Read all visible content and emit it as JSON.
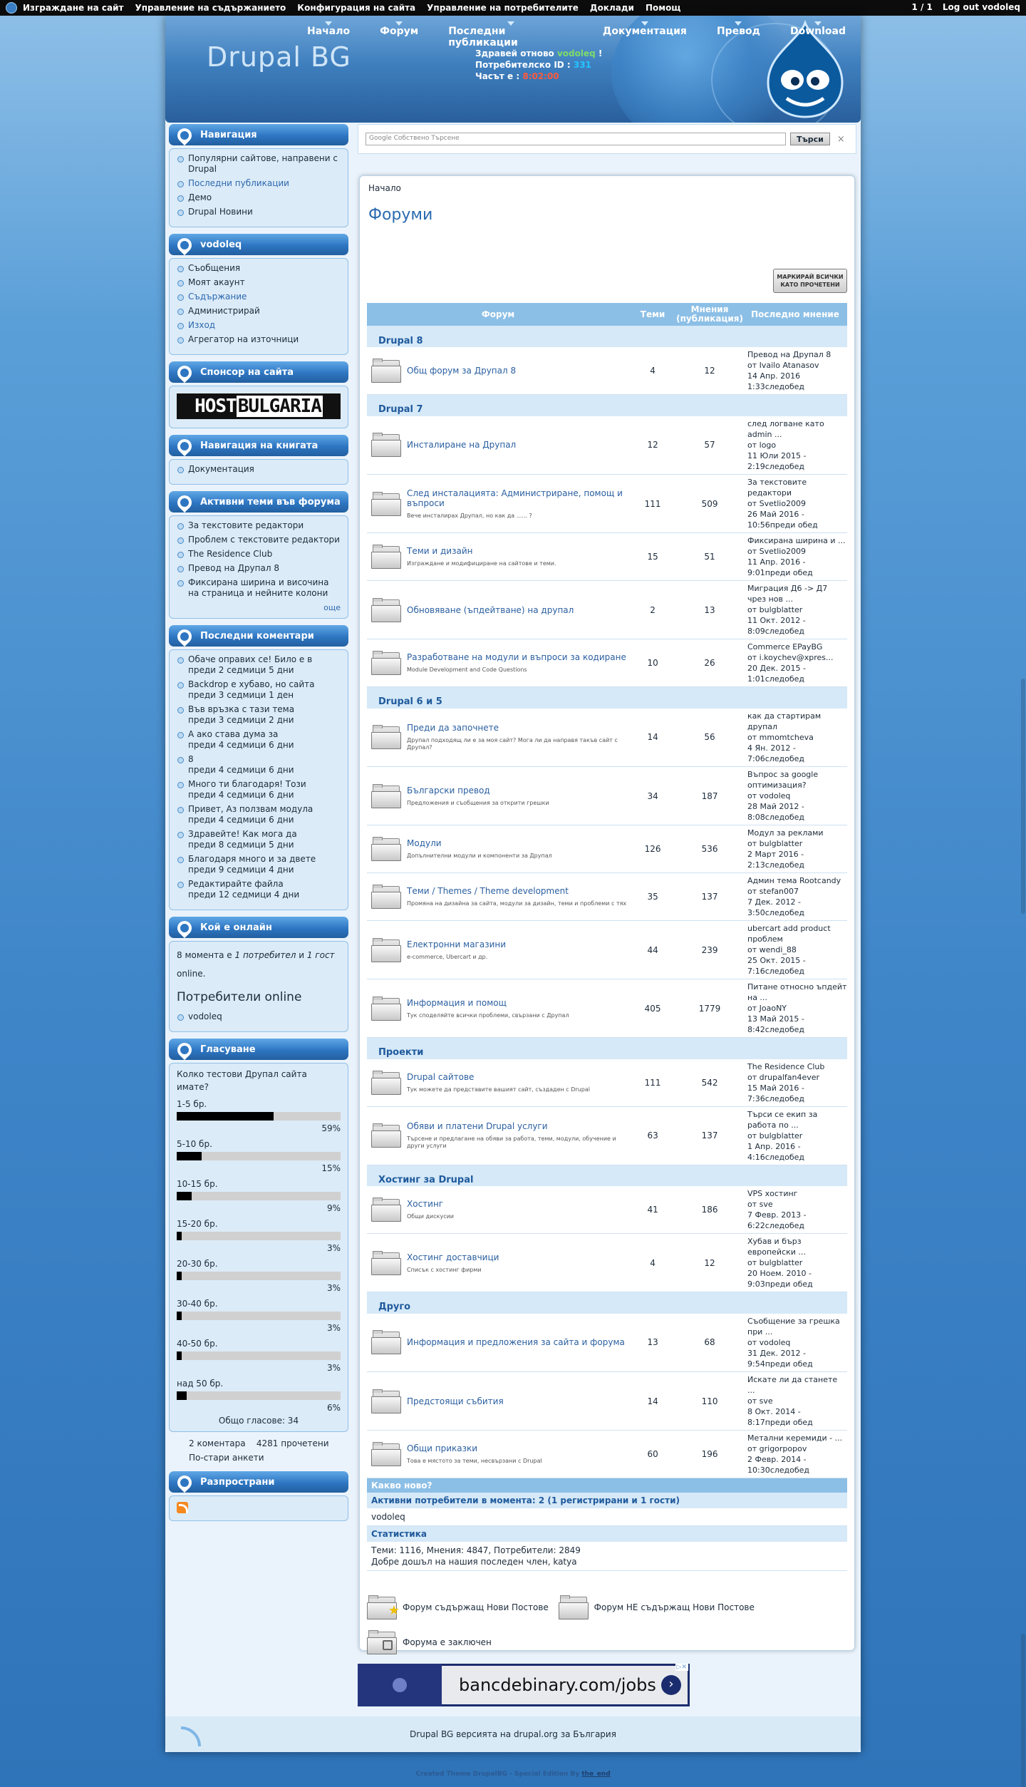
{
  "admin_bar": {
    "menu": [
      "Изграждане на сайт",
      "Управление на съдържанието",
      "Конфигурация на сайта",
      "Управление на потребителите",
      "Доклади",
      "Помощ"
    ],
    "counter": "1 / 1",
    "logout": "Log out vodoleq"
  },
  "header": {
    "site_name": "Drupal BG",
    "nav": [
      "Начало",
      "Форум",
      "Последни публикации",
      "Документация",
      "Превод",
      "Download"
    ],
    "welcome_prefix": "Здравей отново",
    "welcome_user": "vodoleq",
    "welcome_suffix": "!",
    "user_id_label": "Потребителско ID :",
    "user_id_value": "331",
    "time_label": "Часът е :",
    "time_value": "8:02:00"
  },
  "sidebar": {
    "navigation": {
      "title": "Навигация",
      "items": [
        "Популярни сайтове, направени с Drupal",
        "Последни публикации",
        "Демо",
        "Drupal Новини"
      ]
    },
    "user": {
      "title": "vodoleq",
      "items": [
        "Съобщения",
        "Моят акаунт",
        "Съдържание",
        "Администрирай",
        "Изход",
        "Агрегатор на източници"
      ]
    },
    "sponsor": {
      "title": "Спонсор на сайта",
      "banner_a": "HOST",
      "banner_b": "BULGARIA"
    },
    "book_nav": {
      "title": "Навигация на книгата",
      "items": [
        "Документация"
      ]
    },
    "active_topics": {
      "title": "Активни теми във форума",
      "items": [
        "За текстовите редактори",
        "Проблем с текстовите редактори",
        "The Residence Club",
        "Превод на Друпал 8",
        "Фиксирана ширина и височина на страница и нейните колони"
      ],
      "more": "още"
    },
    "comments": {
      "title": "Последни коментари",
      "items": [
        {
          "text": "Обаче оправих се! Било е в",
          "age": "преди 2 седмици 5 дни"
        },
        {
          "text": "Backdrop е хубаво, но сайта",
          "age": "преди 3 седмици 1 ден"
        },
        {
          "text": "Във връзка с тази тема",
          "age": "преди 3 седмици 2 дни"
        },
        {
          "text": "А ако става дума за",
          "age": "преди 4 седмици 6 дни"
        },
        {
          "text": "8",
          "age": "преди 4 седмици 6 дни"
        },
        {
          "text": "Много ти благодаря! Този",
          "age": "преди 4 седмици 6 дни"
        },
        {
          "text": "Привет, Аз ползвам модула",
          "age": "преди 4 седмици 6 дни"
        },
        {
          "text": "Здравейте! Как мога да",
          "age": "преди 8 седмици 5 дни"
        },
        {
          "text": "Благодаря много и за двете",
          "age": "преди 9 седмици 4 дни"
        },
        {
          "text": "Редактирайте файла",
          "age": "преди 12 седмици 4 дни"
        }
      ]
    },
    "online": {
      "title": "Кой е онлайн",
      "pre": "8 момента е",
      "users": "1 потребител",
      "and": "и",
      "guests": "1 гост",
      "post": "online.",
      "heading": "Потребители online",
      "list": [
        "vodoleq"
      ]
    },
    "poll": {
      "title": "Гласуване",
      "question": "Колко тестови Друпал сайта имате?",
      "options": [
        {
          "label": "1-5 бр.",
          "pct_text": "59%",
          "pct": 59
        },
        {
          "label": "5-10 бр.",
          "pct_text": "15%",
          "pct": 15
        },
        {
          "label": "10-15 бр.",
          "pct_text": "9%",
          "pct": 9
        },
        {
          "label": "15-20 бр.",
          "pct_text": "3%",
          "pct": 3
        },
        {
          "label": "20-30 бр.",
          "pct_text": "3%",
          "pct": 3
        },
        {
          "label": "30-40 бр.",
          "pct_text": "3%",
          "pct": 3
        },
        {
          "label": "40-50 бр.",
          "pct_text": "3%",
          "pct": 3
        },
        {
          "label": "над 50 бр.",
          "pct_text": "6%",
          "pct": 6
        }
      ],
      "total": "Общо гласове: 34",
      "comments": "2 коментара",
      "reads": "4281 прочетени",
      "older": "По-стари анкети"
    },
    "share": {
      "title": "Разпространи"
    }
  },
  "search": {
    "placeholder": "Google Собствено Търсене",
    "button": "Търси",
    "close": "×"
  },
  "main": {
    "breadcrumb": "Начало",
    "title": "Форуми",
    "mark_read": "МАРКИРАЙ ВСИЧКИ КАТО ПРОЧЕТЕНИ",
    "cols": {
      "forum": "Форум",
      "topics": "Теми",
      "posts": "Мнения (публикация)",
      "last": "Последно мнение"
    },
    "categories": [
      {
        "name": "Drupal 8",
        "forums": [
          {
            "name": "Общ форум за Друпал 8",
            "desc": "",
            "topics": "4",
            "posts": "12",
            "last": [
              "Превод на Друпал 8",
              "от Ivailo Atanasov",
              "14 Апр. 2016",
              "1:33следобед"
            ]
          }
        ]
      },
      {
        "name": "Drupal 7",
        "forums": [
          {
            "name": "Инсталиране на Друпал",
            "desc": "",
            "topics": "12",
            "posts": "57",
            "last": [
              "след логване като",
              "admin ...",
              "от logo",
              "11 Юли 2015 -",
              "2:19следобед"
            ]
          },
          {
            "name": "След инсталацията: Администриране, помощ и въпроси",
            "desc": "Вече инсталирах Друпал, но как да ...... ?",
            "topics": "111",
            "posts": "509",
            "last": [
              "За текстовите",
              "редактори",
              "от Svetlio2009",
              "26 Май 2016 -",
              "10:56преди обед"
            ]
          },
          {
            "name": "Теми и дизайн",
            "desc": "Изграждане и модифициране на сайтове и теми.",
            "topics": "15",
            "posts": "51",
            "last": [
              "Фиксирана ширина и ...",
              "от Svetlio2009",
              "11 Апр. 2016 -",
              "9:01преди обед"
            ]
          },
          {
            "name": "Обновяване (ъпдейтване) на друпал",
            "desc": "",
            "topics": "2",
            "posts": "13",
            "last": [
              "Миграция Д6 -> Д7",
              "чрез нов ...",
              "от bulgblatter",
              "11 Окт. 2012 -",
              "8:09следобед"
            ]
          },
          {
            "name": "Разработване на модули и въпроси за кодиране",
            "desc": "Module Development and Code Questions",
            "topics": "10",
            "posts": "26",
            "last": [
              "Commerce EPayBG",
              "от i.koychev@xpres...",
              "20 Дек. 2015 -",
              "1:01следобед"
            ]
          }
        ]
      },
      {
        "name": "Drupal 6 и 5",
        "forums": [
          {
            "name": "Преди да започнете",
            "desc": "Друпал подходящ ли е за моя сайт? Мога ли да направя такъв сайт с Друпал?",
            "topics": "14",
            "posts": "56",
            "last": [
              "как да стартирам",
              "друпал",
              "от mmomtcheva",
              "4 Ян. 2012 -",
              "7:06следобед"
            ]
          },
          {
            "name": "Български превод",
            "desc": "Предложения и съобщения за открити грешки",
            "topics": "34",
            "posts": "187",
            "last": [
              "Въпрос за google",
              "оптимизация?",
              "от vodoleq",
              "28 Май 2012 -",
              "8:08следобед"
            ]
          },
          {
            "name": "Модули",
            "desc": "Допълнителни модули и компоненти за Друпал",
            "topics": "126",
            "posts": "536",
            "last": [
              "Модул за реклами",
              "от bulgblatter",
              "2 Март 2016 -",
              "2:13следобед"
            ]
          },
          {
            "name": "Теми / Themes / Theme development",
            "desc": "Промяна на дизайна за сайта, модули за дизайн, теми и проблеми с тях",
            "topics": "35",
            "posts": "137",
            "last": [
              "Админ тема Rootcandy",
              "от stefan007",
              "7 Дек. 2012 -",
              "3:50следобед"
            ]
          },
          {
            "name": "Електронни магазини",
            "desc": "e-commerce, Ubercart и др.",
            "topics": "44",
            "posts": "239",
            "last": [
              "ubercart add product",
              "проблем",
              "от wendi_88",
              "25 Окт. 2015 -",
              "7:16следобед"
            ]
          },
          {
            "name": "Информация и помощ",
            "desc": "Тук споделяйте всички проблеми, свързани с Друпал",
            "topics": "405",
            "posts": "1779",
            "last": [
              "Питане относно ъпдейт",
              "на ...",
              "от JoaoNY",
              "13 Май 2015 -",
              "8:42следобед"
            ]
          }
        ]
      },
      {
        "name": "Проекти",
        "forums": [
          {
            "name": "Drupal сайтове",
            "desc": "Тук можете да представите вашият сайт, създаден с Drupal",
            "topics": "111",
            "posts": "542",
            "last": [
              "The Residence Club",
              "от drupalfan4ever",
              "15 Май 2016 -",
              "7:36следобед"
            ]
          },
          {
            "name": "Обяви и платени Drupal услуги",
            "desc": "Търсене и предлагане на обяви за работа, теми, модули, обучение и други услуги",
            "topics": "63",
            "posts": "137",
            "last": [
              "Търси се екип за",
              "работа по ...",
              "от bulgblatter",
              "1 Апр. 2016 -",
              "4:16следобед"
            ]
          }
        ]
      },
      {
        "name": "Хостинг за Drupal",
        "forums": [
          {
            "name": "Хостинг",
            "desc": "Общи дискусии",
            "topics": "41",
            "posts": "186",
            "last": [
              "VPS хостинг",
              "от sve",
              "7 Февр. 2013 -",
              "6:22следобед"
            ]
          },
          {
            "name": "Хостинг доставчици",
            "desc": "Списък с хостинг фирми",
            "topics": "4",
            "posts": "12",
            "last": [
              "Хубав и бърз",
              "европейски ...",
              "от bulgblatter",
              "20 Ноем. 2010 -",
              "9:03преди обед"
            ]
          }
        ]
      },
      {
        "name": "Друго",
        "forums": [
          {
            "name": "Информация и предложения за сайта и форума",
            "desc": "",
            "topics": "13",
            "posts": "68",
            "last": [
              "Съобщение за грешка",
              "при ...",
              "от vodoleq",
              "31 Дек. 2012 -",
              "9:54преди обед"
            ]
          },
          {
            "name": "Предстоящи събития",
            "desc": "",
            "topics": "14",
            "posts": "110",
            "last": [
              "Искате ли да станете ...",
              "от sve",
              "8 Окт. 2014 -",
              "8:17преди обед"
            ]
          },
          {
            "name": "Общи приказки",
            "desc": "Това е мястото за теми, несвързани с Drupal",
            "topics": "60",
            "posts": "196",
            "last": [
              "Метални керемиди - ...",
              "от grigorpopov",
              "2 Февр. 2014 -",
              "10:30следобед"
            ]
          }
        ]
      }
    ],
    "whats_new": "Какво ново?",
    "active_users": "Активни потребители в момента: 2 (1 регистрирани и 1 гости)",
    "active_user_list": "vodoleq",
    "stats_title": "Статистика",
    "stats_line1": "Теми: 1116, Мнения: 4847, Потребители: 2849",
    "stats_line2": "Добре дошъл на нашия последен член, katya",
    "legend": [
      "Форум съдържащ Нови Постове",
      "Форум НЕ съдържащ Нови Постове",
      "Форума е заключен"
    ]
  },
  "ad": {
    "text": "bancdebinary.com/jobs",
    "arrow": "›",
    "x": "▷✕"
  },
  "footer": {
    "text": "Drupal BG версията на drupal.org за България"
  },
  "credits": {
    "text": "Created Theme DrupalBG - Special Edition By",
    "author": "the_end"
  }
}
